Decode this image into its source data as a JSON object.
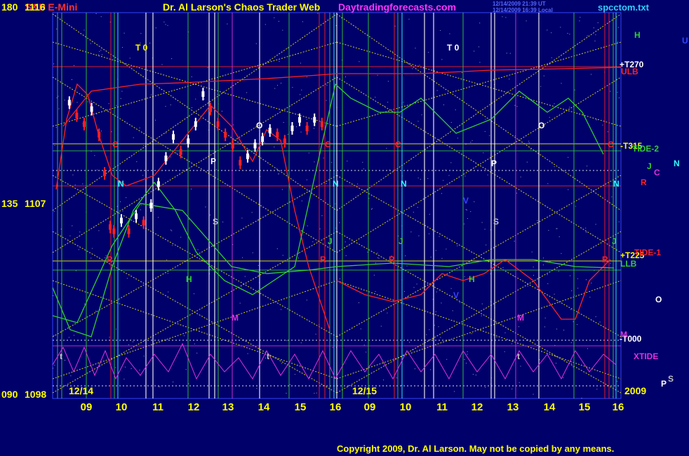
{
  "header": {
    "symbol": "S&P E-Mini",
    "title": "Dr. Al Larson's Chaos Trader Web",
    "site": "Daytradingforecasts.com",
    "file": "spcctom.txt",
    "stamp_ut": "12/14/2009 21:39 UT",
    "stamp_local": "12/14/2009 16:39 Local"
  },
  "footer": {
    "copyright": "Copyright 2009, Dr. Al Larson. May not be copied by any means.",
    "year": "2009"
  },
  "colors": {
    "background": "#00006a",
    "yellow": "#ffff00",
    "red": "#ff2020",
    "green": "#33cc33",
    "white": "#ffffff",
    "magenta": "#dd33dd",
    "cyan": "#33ffff",
    "grey": "#c0c0c0",
    "blue": "#3344ff"
  },
  "chart_data": {
    "type": "line",
    "title": "S&P E-Mini",
    "y_ticks": [
      {
        "angle": "180",
        "price": "1116"
      },
      {
        "angle": "135",
        "price": "1107"
      },
      {
        "angle": "090",
        "price": "1098"
      }
    ],
    "ylim": [
      1098,
      1116
    ],
    "x_ticks": [
      "09",
      "10",
      "11",
      "12",
      "13",
      "14",
      "15",
      "16",
      "09",
      "10",
      "11",
      "12",
      "13",
      "14",
      "15",
      "16"
    ],
    "x_dates": [
      "12/14",
      "12/15"
    ],
    "price_bars_12_14": [
      {
        "x": 8.9,
        "y": 1111.8
      },
      {
        "x": 9.1,
        "y": 1111.2
      },
      {
        "x": 9.3,
        "y": 1110.8
      },
      {
        "x": 9.5,
        "y": 1111.5
      },
      {
        "x": 9.7,
        "y": 1110.3
      },
      {
        "x": 9.85,
        "y": 1108.5
      },
      {
        "x": 10.0,
        "y": 1106.0
      },
      {
        "x": 10.1,
        "y": 1105.8
      },
      {
        "x": 10.3,
        "y": 1106.3
      },
      {
        "x": 10.5,
        "y": 1105.8
      },
      {
        "x": 10.7,
        "y": 1106.5
      },
      {
        "x": 10.9,
        "y": 1106.2
      },
      {
        "x": 11.1,
        "y": 1107.0
      },
      {
        "x": 11.3,
        "y": 1108.0
      },
      {
        "x": 11.5,
        "y": 1109.2
      },
      {
        "x": 11.7,
        "y": 1110.2
      },
      {
        "x": 11.9,
        "y": 1109.5
      },
      {
        "x": 12.1,
        "y": 1110.0
      },
      {
        "x": 12.3,
        "y": 1110.8
      },
      {
        "x": 12.5,
        "y": 1112.2
      },
      {
        "x": 12.7,
        "y": 1111.5
      },
      {
        "x": 12.9,
        "y": 1110.8
      },
      {
        "x": 13.1,
        "y": 1110.3
      },
      {
        "x": 13.3,
        "y": 1109.8
      },
      {
        "x": 13.5,
        "y": 1109.0
      },
      {
        "x": 13.7,
        "y": 1109.3
      },
      {
        "x": 13.9,
        "y": 1109.8
      },
      {
        "x": 14.1,
        "y": 1110.1
      },
      {
        "x": 14.3,
        "y": 1110.5
      },
      {
        "x": 14.5,
        "y": 1110.3
      },
      {
        "x": 14.7,
        "y": 1110.0
      },
      {
        "x": 14.9,
        "y": 1110.6
      },
      {
        "x": 15.1,
        "y": 1111.0
      },
      {
        "x": 15.3,
        "y": 1110.6
      },
      {
        "x": 15.5,
        "y": 1111.0
      },
      {
        "x": 15.7,
        "y": 1110.8
      }
    ],
    "line_labels": [
      {
        "text": "ULB",
        "color": "red"
      },
      {
        "text": "+T270",
        "color": "white"
      },
      {
        "text": "-T315",
        "color": "yellow"
      },
      {
        "text": "TIDE-2",
        "color": "green"
      },
      {
        "text": "+T225",
        "color": "yellow"
      },
      {
        "text": "TIDE-1",
        "color": "red"
      },
      {
        "text": "LLB",
        "color": "green"
      },
      {
        "text": "-T000",
        "color": "white"
      },
      {
        "text": "XTIDE",
        "color": "magenta"
      }
    ],
    "planet_legend": [
      "H",
      "U",
      "J",
      "N",
      "C",
      "R",
      "O",
      "M",
      "P",
      "S"
    ],
    "in_chart_markers": [
      {
        "text": "T 0",
        "color": "yellow"
      },
      {
        "text": "T 0",
        "color": "white"
      },
      {
        "text": "O",
        "color": "white"
      },
      {
        "text": "O",
        "color": "white"
      },
      {
        "text": "C",
        "color": "red"
      },
      {
        "text": "C",
        "color": "red"
      },
      {
        "text": "C",
        "color": "red"
      },
      {
        "text": "C",
        "color": "red"
      },
      {
        "text": "N",
        "color": "cyan"
      },
      {
        "text": "N",
        "color": "cyan"
      },
      {
        "text": "N",
        "color": "cyan"
      },
      {
        "text": "N",
        "color": "cyan"
      },
      {
        "text": "P",
        "color": "white"
      },
      {
        "text": "P",
        "color": "white"
      },
      {
        "text": "S",
        "color": "grey"
      },
      {
        "text": "S",
        "color": "grey"
      },
      {
        "text": "R",
        "color": "red"
      },
      {
        "text": "R",
        "color": "red"
      },
      {
        "text": "R",
        "color": "red"
      },
      {
        "text": "R",
        "color": "red"
      },
      {
        "text": "J",
        "color": "green"
      },
      {
        "text": "J",
        "color": "green"
      },
      {
        "text": "J",
        "color": "green"
      },
      {
        "text": "H",
        "color": "green"
      },
      {
        "text": "H",
        "color": "green"
      },
      {
        "text": "M",
        "color": "magenta"
      },
      {
        "text": "M",
        "color": "magenta"
      },
      {
        "text": "V",
        "color": "blue"
      },
      {
        "text": "V",
        "color": "blue"
      },
      {
        "text": "t",
        "color": "grey"
      },
      {
        "text": "t",
        "color": "grey"
      },
      {
        "text": "t",
        "color": "grey"
      }
    ]
  }
}
